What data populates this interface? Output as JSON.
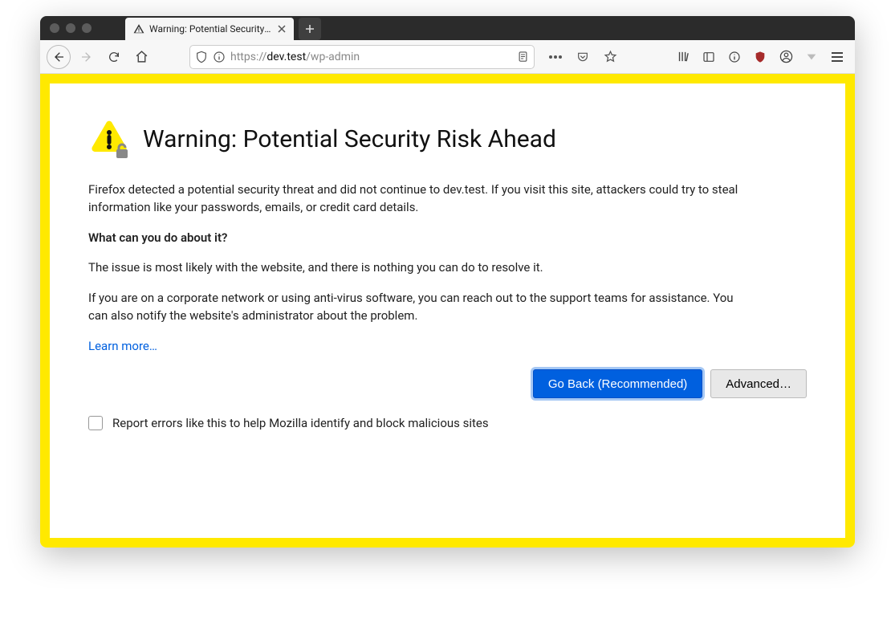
{
  "tab": {
    "title": "Warning: Potential Security Risk"
  },
  "url": {
    "scheme": "https://",
    "host": "dev.test",
    "path": "/wp-admin"
  },
  "page": {
    "heading": "Warning: Potential Security Risk Ahead",
    "intro": "Firefox detected a potential security threat and did not continue to dev.test. If you visit this site, attackers could try to steal information like your passwords, emails, or credit card details.",
    "subheading": "What can you do about it?",
    "p1": "The issue is most likely with the website, and there is nothing you can do to resolve it.",
    "p2": "If you are on a corporate network or using anti-virus software, you can reach out to the support teams for assistance. You can also notify the website's administrator about the problem.",
    "learn_more": "Learn more…",
    "primary_btn": "Go Back (Recommended)",
    "secondary_btn": "Advanced…",
    "report_label": "Report errors like this to help Mozilla identify and block malicious sites"
  }
}
